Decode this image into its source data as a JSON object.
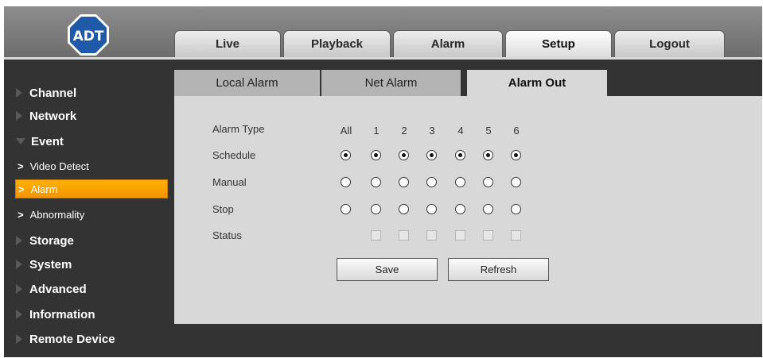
{
  "brand": {
    "logo_text": "ADT",
    "logo_color": "#1e5aa8"
  },
  "top_tabs": [
    {
      "label": "Live",
      "active": false
    },
    {
      "label": "Playback",
      "active": false
    },
    {
      "label": "Alarm",
      "active": false
    },
    {
      "label": "Setup",
      "active": true
    },
    {
      "label": "Logout",
      "active": false
    }
  ],
  "sidebar": {
    "items": [
      {
        "label": "Channel"
      },
      {
        "label": "Network"
      },
      {
        "label": "Event",
        "expanded": true,
        "children": [
          {
            "label": "Video Detect"
          },
          {
            "label": "Alarm",
            "active": true
          },
          {
            "label": "Abnormality"
          }
        ]
      },
      {
        "label": "Storage"
      },
      {
        "label": "System"
      },
      {
        "label": "Advanced"
      },
      {
        "label": "Information"
      },
      {
        "label": "Remote Device"
      }
    ]
  },
  "sub_tabs": [
    {
      "label": "Local Alarm",
      "active": false
    },
    {
      "label": "Net Alarm",
      "active": false
    },
    {
      "label": "Alarm Out",
      "active": true
    }
  ],
  "alarm_out": {
    "headers": [
      "All",
      "1",
      "2",
      "3",
      "4",
      "5",
      "6"
    ],
    "rows": [
      {
        "label": "Alarm Type"
      },
      {
        "label": "Schedule",
        "selected": true
      },
      {
        "label": "Manual",
        "selected": false
      },
      {
        "label": "Stop",
        "selected": false
      },
      {
        "label": "Status"
      }
    ],
    "status": [
      false,
      false,
      false,
      false,
      false,
      false
    ]
  },
  "buttons": {
    "save": "Save",
    "refresh": "Refresh"
  },
  "colors": {
    "accent": "#f5a000",
    "panel": "#d8d8d8",
    "sidebar_bg": "#333333"
  }
}
